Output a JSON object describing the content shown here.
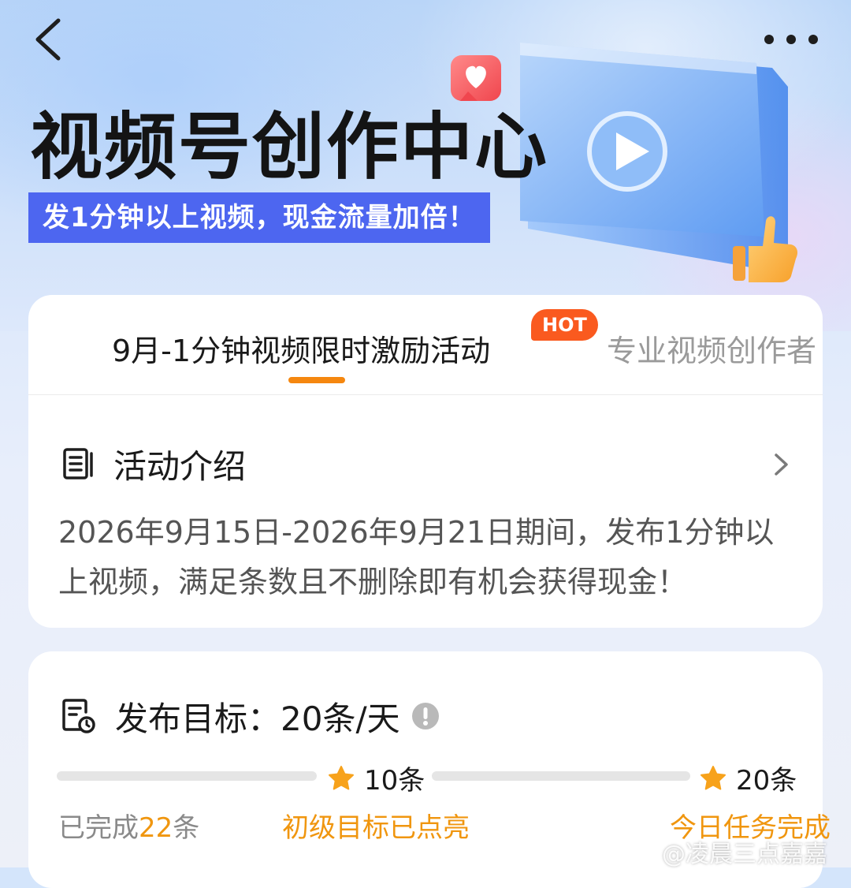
{
  "header": {
    "title": "视频号创作中心",
    "slogan": "发1分钟以上视频，现金流量加倍！"
  },
  "tabs": {
    "active_label": "9月-1分钟视频限时激励活动",
    "hot_badge": "HOT",
    "inactive_label": "专业视频创作者"
  },
  "intro": {
    "title": "活动介绍",
    "text": "2026年9月15日-2026年9月21日期间，发布1分钟以上视频，满足条数且不删除即有机会获得现金！"
  },
  "goal": {
    "title": "发布目标：20条/天",
    "milestone_1": "10条",
    "milestone_2": "20条",
    "done_prefix": "已完成",
    "done_count": "22",
    "done_suffix": "条",
    "level_status": "初级目标已点亮",
    "today_status": "今日任务完成",
    "progress_segment_1": 0,
    "progress_segment_2": 0
  },
  "watermark": "@凌晨三点嘉嘉",
  "colors": {
    "accent_orange": "#f5870f",
    "slogan_blue": "#4d66f0",
    "hot_red": "#fa5a1f"
  }
}
